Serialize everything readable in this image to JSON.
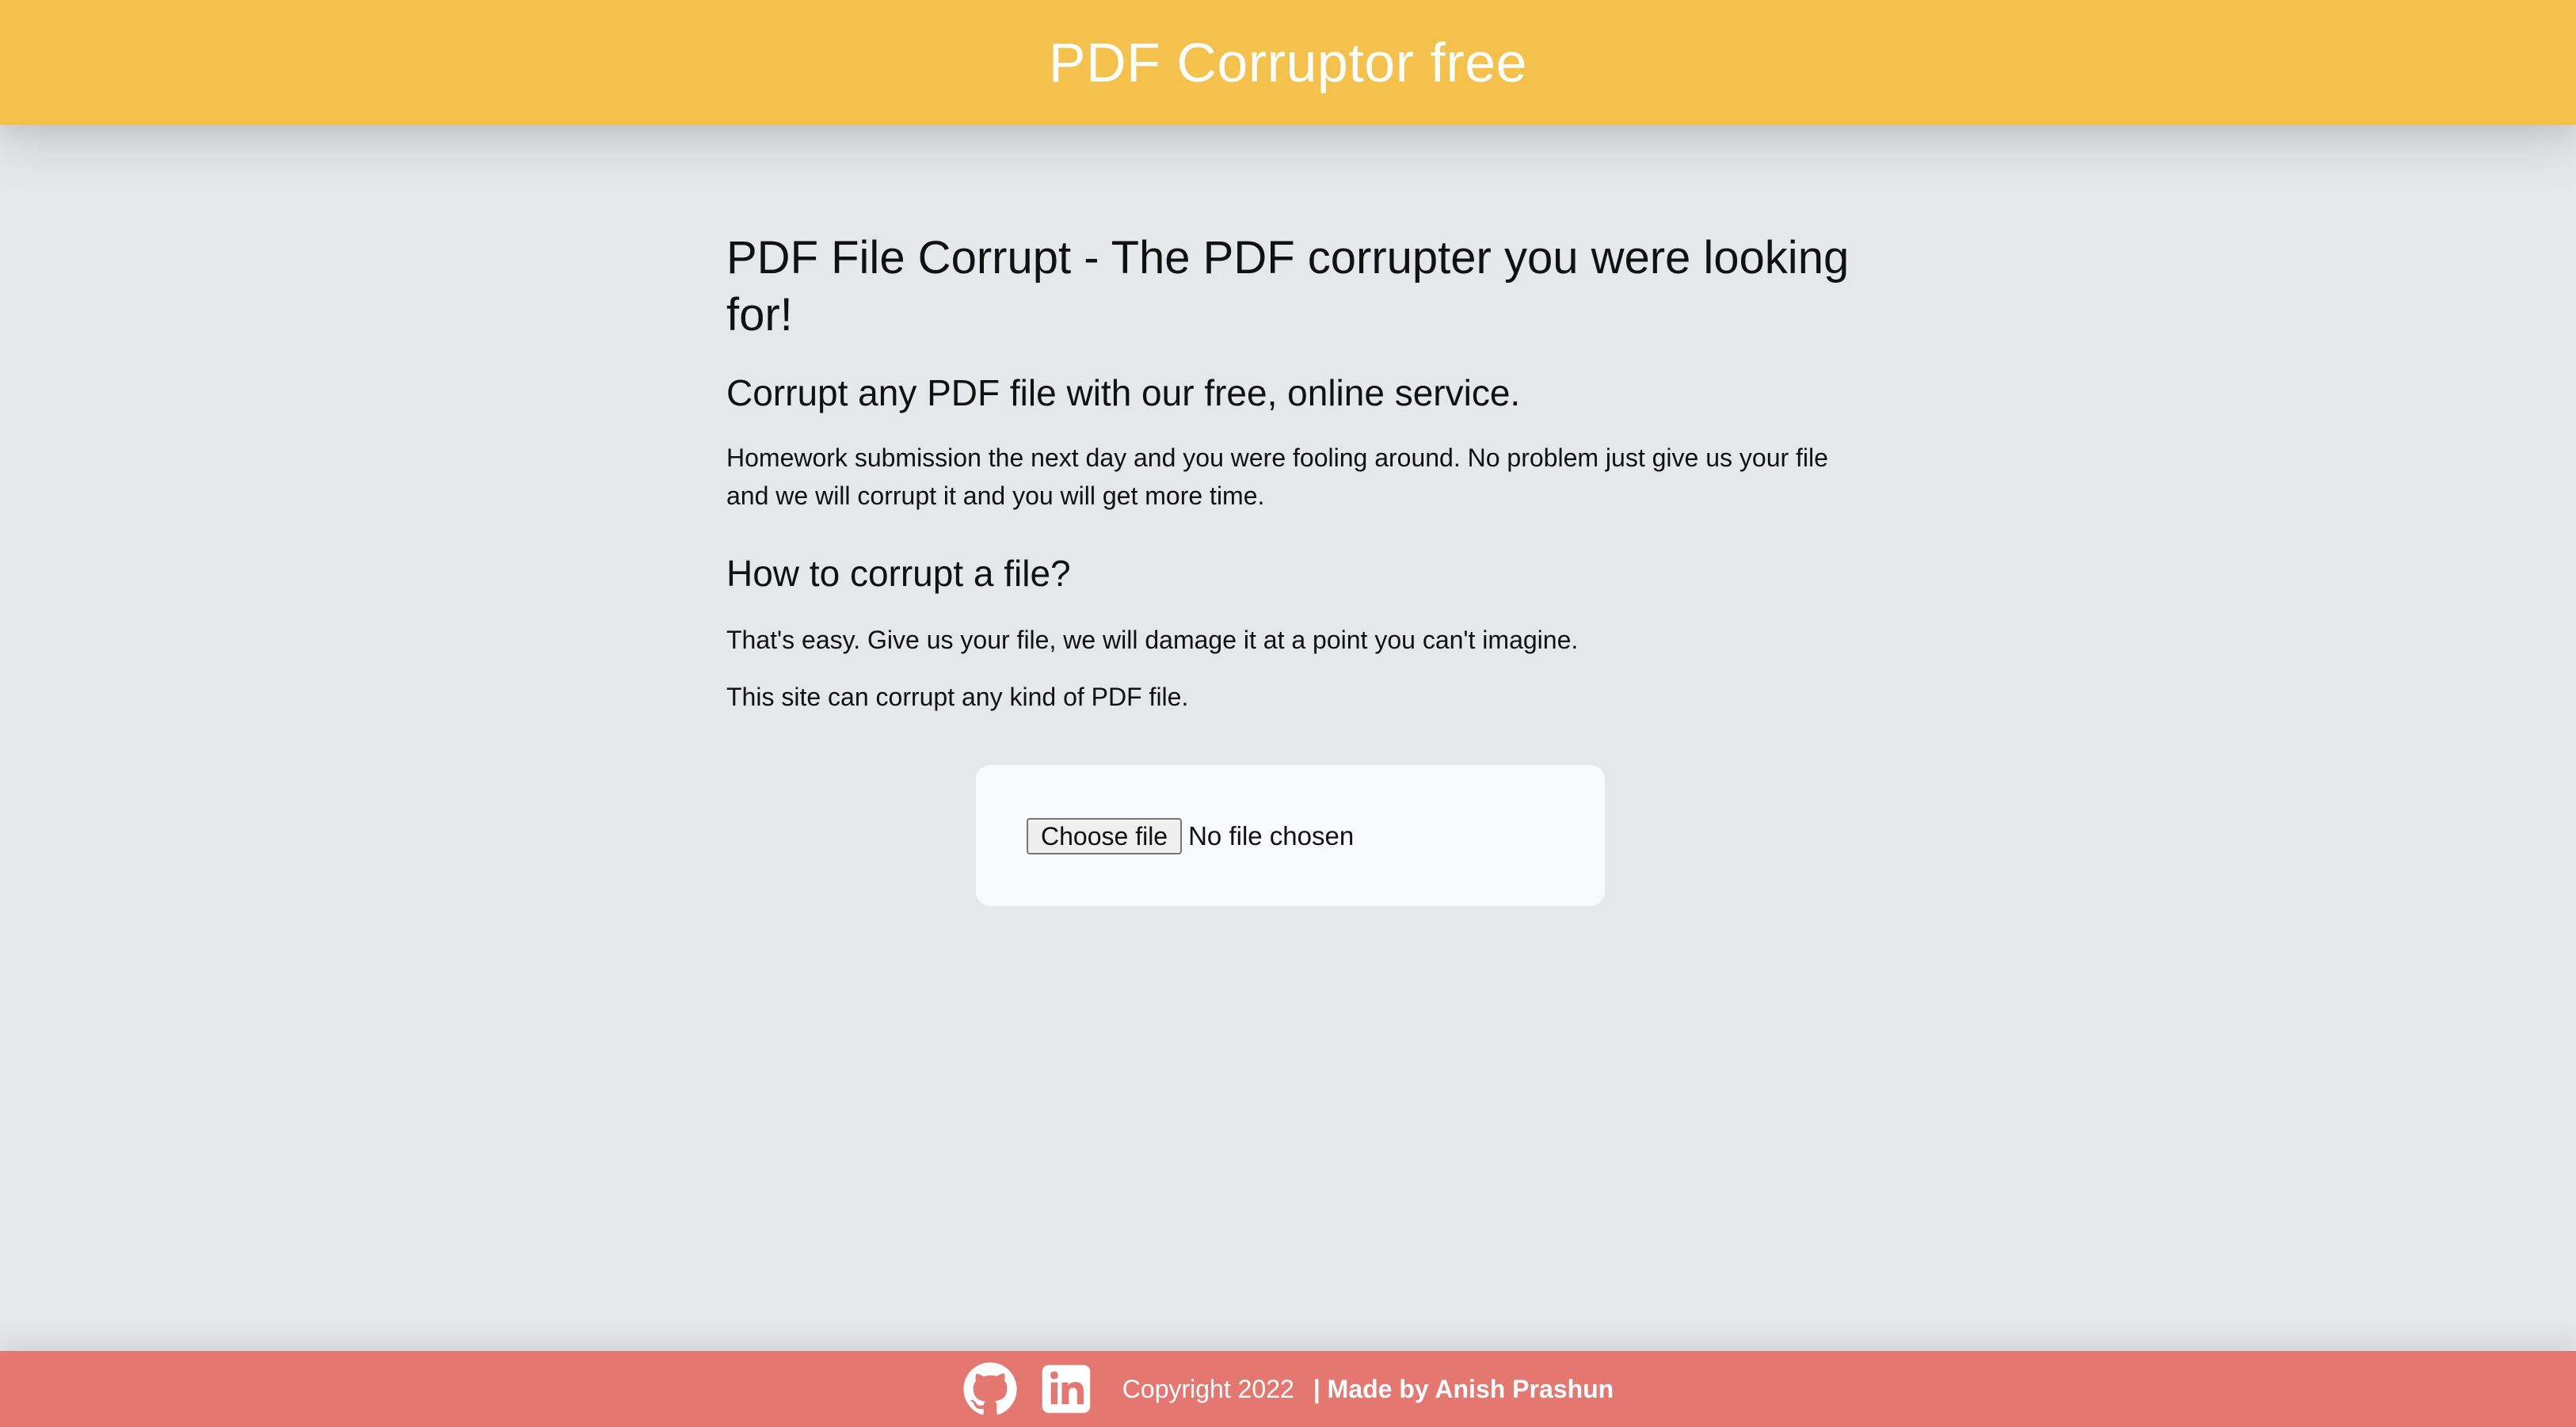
{
  "header": {
    "title": "PDF Corruptor free"
  },
  "main": {
    "headline": "PDF File Corrupt - The PDF corrupter you were looking for!",
    "subheading": "Corrupt any PDF file with our free, online service.",
    "intro": "Homework submission the next day and you were fooling around. No problem just give us your file and we will corrupt it and you will get more time.",
    "how_heading": "How to corrupt a file?",
    "how_text": "That's easy. Give us your file, we will damage it at a point you can't imagine.",
    "kind_text": "This site can corrupt any kind of PDF file."
  },
  "upload": {
    "button_label": "Choose file",
    "status": "No file chosen"
  },
  "footer": {
    "icons": [
      "github-icon",
      "linkedin-icon"
    ],
    "copyright": "Copyright 2022",
    "made_by": "| Made by Anish Prashun"
  },
  "colors": {
    "header": "#f3c14c",
    "background": "#e5e7eb",
    "card": "#f8f9fb",
    "footer": "#e57771",
    "text": "#111111",
    "white": "#ffffff"
  }
}
